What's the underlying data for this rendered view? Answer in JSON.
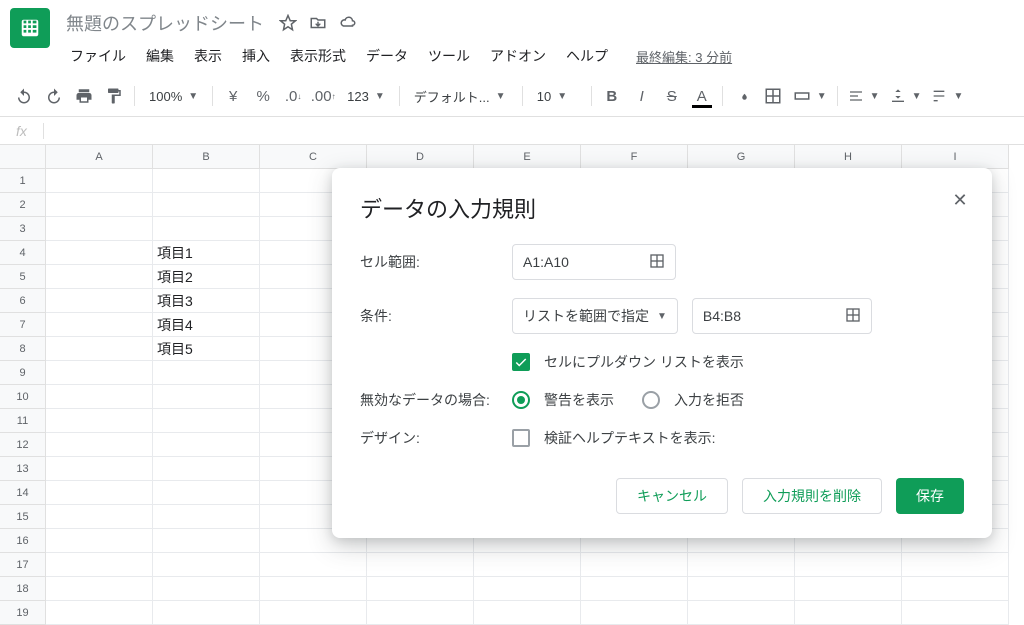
{
  "doc_title": "無題のスプレッドシート",
  "menus": [
    "ファイル",
    "編集",
    "表示",
    "挿入",
    "表示形式",
    "データ",
    "ツール",
    "アドオン",
    "ヘルプ"
  ],
  "last_edit": "最終編集: 3 分前",
  "toolbar": {
    "zoom": "100%",
    "currency": "¥",
    "percent": "%",
    "format_menu": "123",
    "font": "デフォルト...",
    "font_size": "10",
    "text_color_letter": "A"
  },
  "columns": [
    "A",
    "B",
    "C",
    "D",
    "E",
    "F",
    "G",
    "H",
    "I"
  ],
  "row_count": 19,
  "cells": {
    "B4": "項目1",
    "B5": "項目2",
    "B6": "項目3",
    "B7": "項目4",
    "B8": "項目5"
  },
  "dialog": {
    "title": "データの入力規則",
    "labels": {
      "cell_range": "セル範囲:",
      "criteria": "条件:",
      "invalid_data": "無効なデータの場合:",
      "design": "デザイン:"
    },
    "cell_range_value": "A1:A10",
    "criteria_type": "リストを範囲で指定",
    "criteria_range": "B4:B8",
    "show_dropdown_label": "セルにプルダウン リストを表示",
    "show_dropdown_checked": true,
    "invalid_options": {
      "warn": "警告を表示",
      "reject": "入力を拒否"
    },
    "invalid_selected": "warn",
    "design_checkbox_label": "検証ヘルプテキストを表示:",
    "design_checked": false,
    "actions": {
      "cancel": "キャンセル",
      "remove": "入力規則を削除",
      "save": "保存"
    }
  }
}
